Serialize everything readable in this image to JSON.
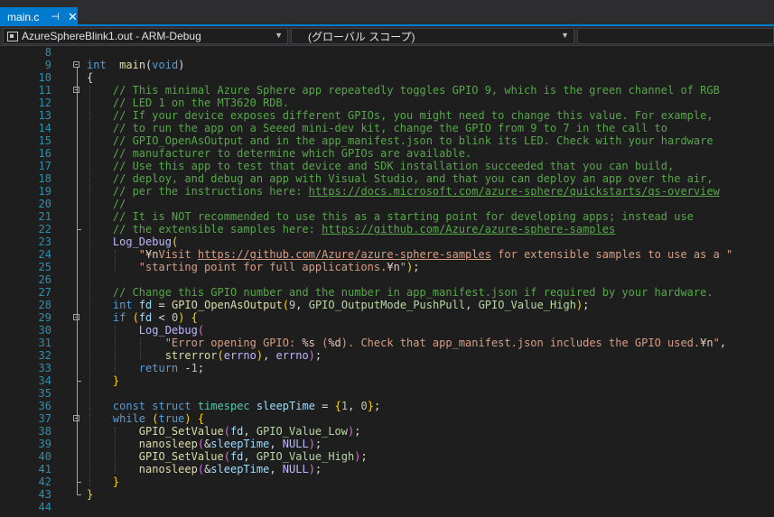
{
  "tab": {
    "filename": "main.c",
    "pin": "⊣",
    "close": "✕"
  },
  "nav": {
    "project": "AzureSphereBlink1.out - ARM-Debug",
    "scope": "(グローバル スコープ)",
    "member": ""
  },
  "lines": [
    {
      "n": "8",
      "segs": []
    },
    {
      "n": "9",
      "segs": [
        [
          "kw",
          "int"
        ],
        [
          "",
          "  "
        ],
        [
          "fn",
          "main"
        ],
        [
          "",
          "("
        ],
        [
          "kw",
          "void"
        ],
        [
          "",
          ")"
        ]
      ]
    },
    {
      "n": "10",
      "segs": [
        [
          "",
          "{"
        ]
      ]
    },
    {
      "n": "11",
      "segs": [
        [
          "",
          "    "
        ],
        [
          "cm",
          "// This minimal Azure Sphere app repeatedly toggles GPIO 9, which is the green channel of RGB"
        ]
      ]
    },
    {
      "n": "12",
      "segs": [
        [
          "",
          "    "
        ],
        [
          "cm",
          "// LED 1 on the MT3620 RDB."
        ]
      ]
    },
    {
      "n": "13",
      "segs": [
        [
          "",
          "    "
        ],
        [
          "cm",
          "// If your device exposes different GPIOs, you might need to change this value. For example,"
        ]
      ]
    },
    {
      "n": "14",
      "segs": [
        [
          "",
          "    "
        ],
        [
          "cm",
          "// to run the app on a Seeed mini-dev kit, change the GPIO from 9 to 7 in the call to"
        ]
      ]
    },
    {
      "n": "15",
      "segs": [
        [
          "",
          "    "
        ],
        [
          "cm",
          "// GPIO_OpenAsOutput and in the app_manifest.json to blink its LED. Check with your hardware"
        ]
      ]
    },
    {
      "n": "16",
      "segs": [
        [
          "",
          "    "
        ],
        [
          "cm",
          "// manufacturer to determine which GPIOs are available."
        ]
      ]
    },
    {
      "n": "17",
      "segs": [
        [
          "",
          "    "
        ],
        [
          "cm",
          "// Use this app to test that device and SDK installation succeeded that you can build,"
        ]
      ]
    },
    {
      "n": "18",
      "segs": [
        [
          "",
          "    "
        ],
        [
          "cm",
          "// deploy, and debug an app with Visual Studio, and that you can deploy an app over the air,"
        ]
      ]
    },
    {
      "n": "19",
      "segs": [
        [
          "",
          "    "
        ],
        [
          "cm",
          "// per the instructions here: "
        ],
        [
          "cm ul",
          "https://docs.microsoft.com/azure-sphere/quickstarts/qs-overview"
        ]
      ]
    },
    {
      "n": "20",
      "segs": [
        [
          "",
          "    "
        ],
        [
          "cm",
          "//"
        ]
      ]
    },
    {
      "n": "21",
      "segs": [
        [
          "",
          "    "
        ],
        [
          "cm",
          "// It is NOT recommended to use this as a starting point for developing apps; instead use"
        ]
      ]
    },
    {
      "n": "22",
      "segs": [
        [
          "",
          "    "
        ],
        [
          "cm",
          "// the extensible samples here: "
        ],
        [
          "cm ul",
          "https://github.com/Azure/azure-sphere-samples"
        ]
      ]
    },
    {
      "n": "23",
      "segs": [
        [
          "",
          "    "
        ],
        [
          "mac",
          "Log_Debug"
        ],
        [
          "br1",
          "("
        ]
      ]
    },
    {
      "n": "24",
      "segs": [
        [
          "",
          "        "
        ],
        [
          "str",
          "\""
        ],
        [
          "esc",
          "¥n"
        ],
        [
          "str",
          "Visit "
        ],
        [
          "str ul",
          "https://github.com/Azure/azure-sphere-samples"
        ],
        [
          "str",
          " for extensible samples to use as a \""
        ]
      ]
    },
    {
      "n": "25",
      "segs": [
        [
          "",
          "        "
        ],
        [
          "str",
          "\"starting point for full applications."
        ],
        [
          "esc",
          "¥n"
        ],
        [
          "str",
          "\""
        ],
        [
          "br1",
          ")"
        ],
        [
          "",
          ";"
        ]
      ]
    },
    {
      "n": "26",
      "segs": []
    },
    {
      "n": "27",
      "segs": [
        [
          "",
          "    "
        ],
        [
          "cm",
          "// Change this GPIO number and the number in app_manifest.json if required by your hardware."
        ]
      ]
    },
    {
      "n": "28",
      "segs": [
        [
          "",
          "    "
        ],
        [
          "kw",
          "int"
        ],
        [
          "",
          " "
        ],
        [
          "loc",
          "fd"
        ],
        [
          "",
          " = "
        ],
        [
          "fn",
          "GPIO_OpenAsOutput"
        ],
        [
          "br1",
          "("
        ],
        [
          "num",
          "9"
        ],
        [
          "",
          ", "
        ],
        [
          "enm",
          "GPIO_OutputMode_PushPull"
        ],
        [
          "",
          ", "
        ],
        [
          "enm",
          "GPIO_Value_High"
        ],
        [
          "br1",
          ")"
        ],
        [
          "",
          ";"
        ]
      ]
    },
    {
      "n": "29",
      "segs": [
        [
          "",
          "    "
        ],
        [
          "kw",
          "if"
        ],
        [
          "",
          " "
        ],
        [
          "br1",
          "("
        ],
        [
          "loc",
          "fd"
        ],
        [
          "",
          " < "
        ],
        [
          "num",
          "0"
        ],
        [
          "br1",
          ")"
        ],
        [
          "",
          " "
        ],
        [
          "br1",
          "{"
        ]
      ]
    },
    {
      "n": "30",
      "segs": [
        [
          "",
          "        "
        ],
        [
          "mac",
          "Log_Debug"
        ],
        [
          "br2",
          "("
        ]
      ]
    },
    {
      "n": "31",
      "segs": [
        [
          "",
          "            "
        ],
        [
          "str",
          "\"Error opening GPIO: "
        ],
        [
          "esc",
          "%s"
        ],
        [
          "str",
          " ("
        ],
        [
          "esc",
          "%d"
        ],
        [
          "str",
          "). Check that app_manifest.json includes the GPIO used."
        ],
        [
          "esc",
          "¥n"
        ],
        [
          "str",
          "\""
        ],
        [
          "",
          ","
        ]
      ]
    },
    {
      "n": "32",
      "segs": [
        [
          "",
          "            "
        ],
        [
          "fn",
          "strerror"
        ],
        [
          "br1",
          "("
        ],
        [
          "mac",
          "errno"
        ],
        [
          "br1",
          ")"
        ],
        [
          "",
          ", "
        ],
        [
          "mac",
          "errno"
        ],
        [
          "br2",
          ")"
        ],
        [
          "",
          ";"
        ]
      ]
    },
    {
      "n": "33",
      "segs": [
        [
          "",
          "        "
        ],
        [
          "kw",
          "return"
        ],
        [
          "",
          " -"
        ],
        [
          "num",
          "1"
        ],
        [
          "",
          ";"
        ]
      ]
    },
    {
      "n": "34",
      "segs": [
        [
          "",
          "    "
        ],
        [
          "br1",
          "}"
        ]
      ]
    },
    {
      "n": "35",
      "segs": []
    },
    {
      "n": "36",
      "segs": [
        [
          "",
          "    "
        ],
        [
          "kw",
          "const"
        ],
        [
          "",
          " "
        ],
        [
          "kw",
          "struct"
        ],
        [
          "",
          " "
        ],
        [
          "ty",
          "timespec"
        ],
        [
          "",
          " "
        ],
        [
          "loc",
          "sleepTime"
        ],
        [
          "",
          " = "
        ],
        [
          "br1",
          "{"
        ],
        [
          "num",
          "1"
        ],
        [
          "",
          ", "
        ],
        [
          "num",
          "0"
        ],
        [
          "br1",
          "}"
        ],
        [
          "",
          ";"
        ]
      ]
    },
    {
      "n": "37",
      "segs": [
        [
          "",
          "    "
        ],
        [
          "kw",
          "while"
        ],
        [
          "",
          " "
        ],
        [
          "br1",
          "("
        ],
        [
          "kw",
          "true"
        ],
        [
          "br1",
          ")"
        ],
        [
          "",
          " "
        ],
        [
          "br1",
          "{"
        ]
      ]
    },
    {
      "n": "38",
      "segs": [
        [
          "",
          "        "
        ],
        [
          "fn",
          "GPIO_SetValue"
        ],
        [
          "br2",
          "("
        ],
        [
          "loc",
          "fd"
        ],
        [
          "",
          ", "
        ],
        [
          "enm",
          "GPIO_Value_Low"
        ],
        [
          "br2",
          ")"
        ],
        [
          "",
          ";"
        ]
      ]
    },
    {
      "n": "39",
      "segs": [
        [
          "",
          "        "
        ],
        [
          "fn",
          "nanosleep"
        ],
        [
          "br2",
          "("
        ],
        [
          "",
          "&"
        ],
        [
          "loc",
          "sleepTime"
        ],
        [
          "",
          ", "
        ],
        [
          "mac",
          "NULL"
        ],
        [
          "br2",
          ")"
        ],
        [
          "",
          ";"
        ]
      ]
    },
    {
      "n": "40",
      "segs": [
        [
          "",
          "        "
        ],
        [
          "fn",
          "GPIO_SetValue"
        ],
        [
          "br2",
          "("
        ],
        [
          "loc",
          "fd"
        ],
        [
          "",
          ", "
        ],
        [
          "enm",
          "GPIO_Value_High"
        ],
        [
          "br2",
          ")"
        ],
        [
          "",
          ";"
        ]
      ]
    },
    {
      "n": "41",
      "segs": [
        [
          "",
          "        "
        ],
        [
          "fn",
          "nanosleep"
        ],
        [
          "br2",
          "("
        ],
        [
          "",
          "&"
        ],
        [
          "loc",
          "sleepTime"
        ],
        [
          "",
          ", "
        ],
        [
          "mac",
          "NULL"
        ],
        [
          "br2",
          ")"
        ],
        [
          "",
          ";"
        ]
      ]
    },
    {
      "n": "42",
      "segs": [
        [
          "",
          "    "
        ],
        [
          "br1",
          "}"
        ]
      ]
    },
    {
      "n": "43",
      "segs": [
        [
          "br1",
          "}"
        ]
      ]
    },
    {
      "n": "44",
      "segs": []
    }
  ],
  "folds": [
    {
      "start": "9",
      "end": "43"
    },
    {
      "start": "11",
      "end": "22"
    },
    {
      "start": "29",
      "end": "34"
    },
    {
      "start": "37",
      "end": "42"
    }
  ],
  "colors": {
    "accent": "#007acc",
    "background": "#1e1e1e",
    "line_number": "#2b91af",
    "comment": "#57a64a",
    "keyword": "#569cd6",
    "string": "#d69d85"
  }
}
